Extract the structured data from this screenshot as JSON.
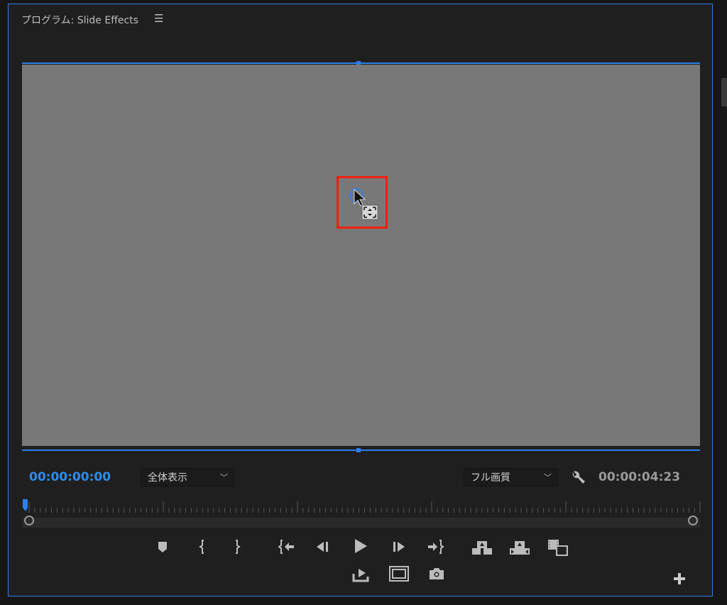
{
  "panel": {
    "title": "プログラム: Slide Effects",
    "menu_icon": "hamburger-menu-icon"
  },
  "playback": {
    "current_timecode": "00:00:00:00",
    "duration_timecode": "00:00:04:23",
    "playhead_fraction": 0.0
  },
  "zoom_select": {
    "value": "全体表示"
  },
  "quality_select": {
    "value": "フル画質"
  },
  "colors": {
    "accent": "#2d7ff0",
    "highlight": "#f0200c",
    "video_bg": "#787878",
    "panel_bg": "#1f1f1f"
  }
}
